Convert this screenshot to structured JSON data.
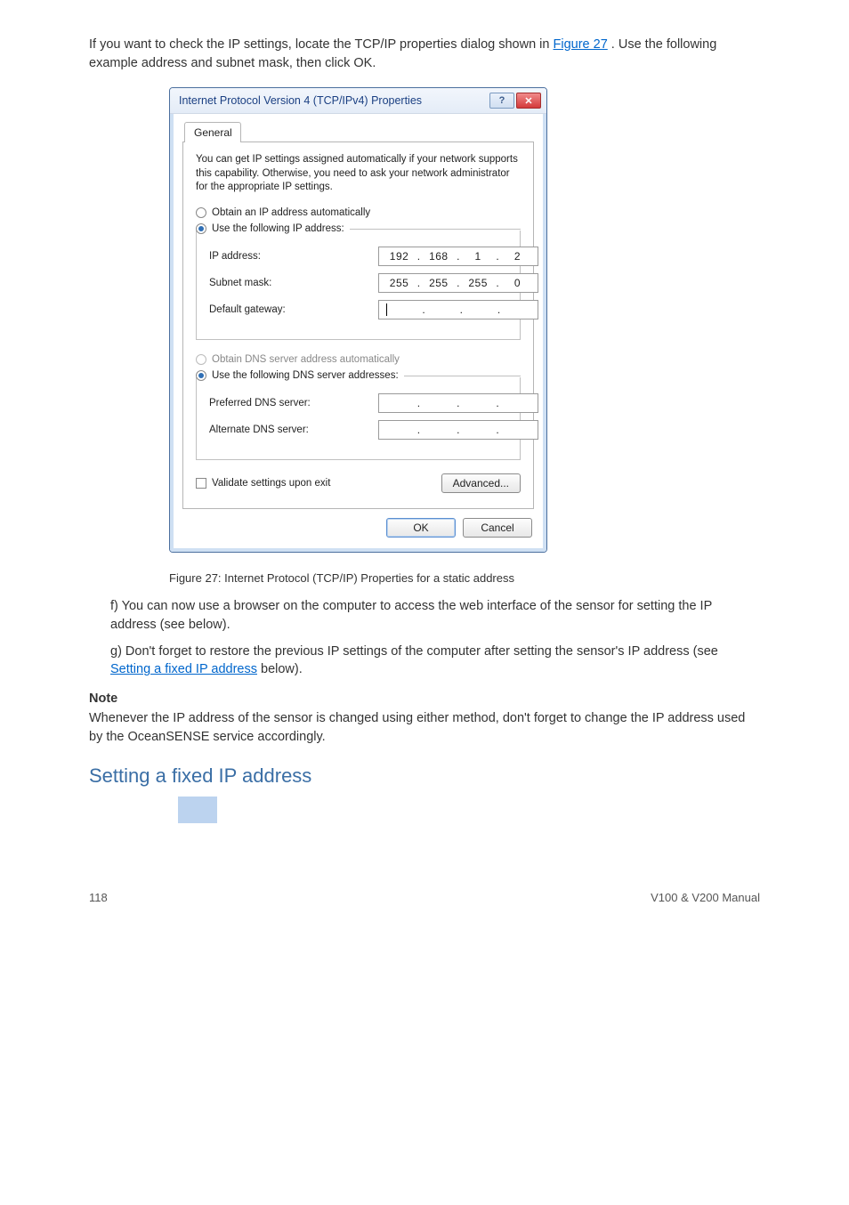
{
  "doc": {
    "para1_before_fig": "If you want to check the IP settings, locate the TCP/IP properties dialog shown in ",
    "figlink1": "Figure 27",
    "para1_after_fig": ". Use the following example address and subnet mask, then click OK.",
    "fig_caption": "Figure 27: Internet Protocol (TCP/IP) Properties for a static address",
    "para2": "f) You can now use a browser on the computer to access the web interface of the sensor for setting the IP address (see below).",
    "para3_prefix": "g) Don't forget to restore the previous IP settings of the computer after setting the sensor's IP address (see ",
    "para3_link": "Setting a fixed IP address",
    "para3_suffix": " below).",
    "note_title": "Note",
    "note_body": "Whenever the IP address of the sensor is changed using either method, don't forget to change the IP address used by the OceanSENSE service accordingly.",
    "section_h": "Setting a fixed IP address"
  },
  "dialog": {
    "title": "Internet Protocol Version 4 (TCP/IPv4) Properties",
    "tab": "General",
    "desc": "You can get IP settings assigned automatically if your network supports this capability. Otherwise, you need to ask your network administrator for the appropriate IP settings.",
    "radio_auto_ip": "Obtain an IP address automatically",
    "radio_use_ip": "Use the following IP address:",
    "lbl_ip": "IP address:",
    "lbl_subnet": "Subnet mask:",
    "lbl_gateway": "Default gateway:",
    "radio_auto_dns": "Obtain DNS server address automatically",
    "radio_use_dns": "Use the following DNS server addresses:",
    "lbl_pref_dns": "Preferred DNS server:",
    "lbl_alt_dns": "Alternate DNS server:",
    "chk_validate": "Validate settings upon exit",
    "btn_advanced": "Advanced...",
    "btn_ok": "OK",
    "btn_cancel": "Cancel",
    "ip": {
      "a": "192",
      "b": "168",
      "c": "1",
      "d": "2"
    },
    "mask": {
      "a": "255",
      "b": "255",
      "c": "255",
      "d": "0"
    }
  },
  "footer": {
    "left": "118",
    "right": "V100 & V200 Manual"
  }
}
